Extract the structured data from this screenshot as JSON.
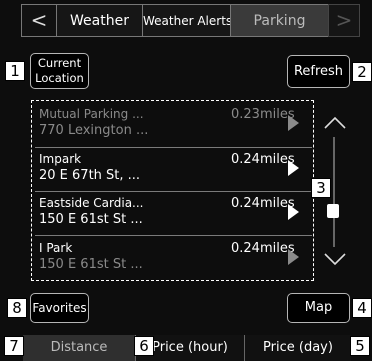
{
  "tabs": {
    "back_glyph": "<",
    "weather": "Weather",
    "weather_alerts": "Weather Alerts",
    "parking": "Parking",
    "next_glyph": ">"
  },
  "buttons": {
    "current_location_line1": "Current",
    "current_location_line2": "Location",
    "refresh": "Refresh",
    "favorites": "Favorites",
    "map": "Map"
  },
  "parking_list": [
    {
      "name": "Mutual Parking ...",
      "address": "770 Lexington ...",
      "distance": "0.23miles",
      "dimmed": true
    },
    {
      "name": "Impark",
      "address": "20 E 67th St, ...",
      "distance": "0.24miles",
      "dimmed": false
    },
    {
      "name": "Eastside Cardia...",
      "address": "150 E 61st St ...",
      "distance": "0.24miles",
      "dimmed": false
    },
    {
      "name": "I Park",
      "address": "150 E 61st St ...",
      "distance": "0.24miles",
      "dimmed": false
    }
  ],
  "scrollbar": {
    "up_icon": "chevron-up-icon",
    "down_icon": "chevron-down-icon"
  },
  "sort_tabs": {
    "distance": "Distance",
    "price_hour": "Price (hour)",
    "price_day": "Price (day)"
  },
  "callouts": {
    "c1": "1",
    "c2": "2",
    "c3": "3",
    "c4": "4",
    "c5": "5",
    "c6": "6",
    "c7": "7",
    "c8": "8"
  },
  "colors": {
    "background": "#0d0d0d",
    "active_tab": "#3a3a3a",
    "dimmed_text": "#8a8a8a"
  }
}
